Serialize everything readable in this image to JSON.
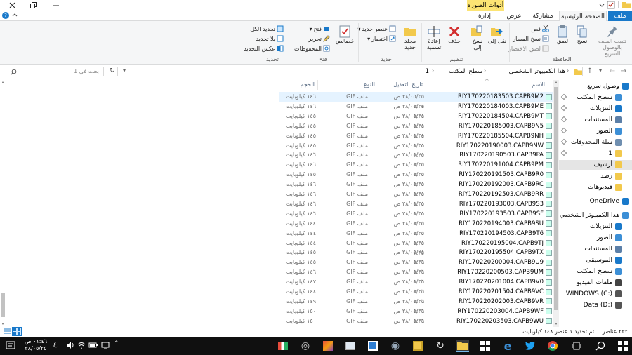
{
  "window": {
    "context_tab_title": "أدوات الصورة"
  },
  "tabs": {
    "file": "ملف",
    "home": "الصفحة الرئيسية",
    "share": "مشاركة",
    "view": "عرض",
    "manage": "إدارة"
  },
  "ribbon": {
    "clipboard": {
      "label": "الحافظة",
      "pin": "تثبيت الملف بالوصول السريع",
      "copy": "نسخ",
      "paste": "لصق",
      "cut": "قص",
      "copy_path": "نسخ المسار",
      "paste_shortcut": "لصق الاختصار"
    },
    "organize": {
      "label": "تنظيم",
      "move_to": "نقل إلى",
      "copy_to": "نسخ إلى",
      "delete": "حذف",
      "rename": "إعادة تسمية"
    },
    "new": {
      "label": "جديد",
      "new_folder": "مجلد جديد",
      "new_item": "عنصر جديد",
      "easy_access": "اختصار"
    },
    "open": {
      "label": "فتح",
      "properties": "خصائص",
      "open": "فتح",
      "edit": "تحرير",
      "history": "المحفوظات"
    },
    "select": {
      "label": "تحديد",
      "select_all": "تحديد الكل",
      "select_none": "بلا تحديد",
      "invert": "عكس التحديد"
    }
  },
  "address": {
    "crumbs": [
      "هذا الكمبيوتر الشخصي",
      "سطح المكتب",
      "1"
    ],
    "search_placeholder": "بحث في 1"
  },
  "nav": [
    {
      "label": "وصول سريع",
      "icon": "star-icon",
      "pinned": false,
      "color": "#1979ca"
    },
    {
      "label": "سطح المكتب",
      "icon": "desktop-icon",
      "pinned": true,
      "color": "#3c8fd6"
    },
    {
      "label": "التنزيلات",
      "icon": "download-icon",
      "pinned": true,
      "color": "#1979ca"
    },
    {
      "label": "المستندات",
      "icon": "document-icon",
      "pinned": true,
      "color": "#5b7fa8"
    },
    {
      "label": "الصور",
      "icon": "pictures-icon",
      "pinned": true,
      "color": "#3c8fd6"
    },
    {
      "label": "سلة المحذوفات",
      "icon": "recycle-bin-icon",
      "pinned": true,
      "color": "#6f8fb0"
    },
    {
      "label": "1",
      "icon": "folder-icon",
      "pinned": true,
      "color": "#f2c94c"
    },
    {
      "label": "أرشيف",
      "icon": "folder-icon",
      "pinned": false,
      "color": "#f2c94c"
    },
    {
      "label": "رصد",
      "icon": "folder-icon",
      "pinned": false,
      "color": "#f2c94c"
    },
    {
      "label": "فيديوهات",
      "icon": "folder-icon",
      "pinned": false,
      "color": "#f2c94c"
    },
    {
      "label": "OneDrive",
      "icon": "cloud-icon",
      "pinned": false,
      "color": "#1979ca"
    },
    {
      "label": "هذا الكمبيوتر الشخصي",
      "icon": "computer-icon",
      "pinned": false,
      "color": "#3c8fd6"
    },
    {
      "label": "التنزيلات",
      "icon": "download-icon",
      "pinned": false,
      "color": "#1979ca"
    },
    {
      "label": "الصور",
      "icon": "pictures-icon",
      "pinned": false,
      "color": "#3c8fd6"
    },
    {
      "label": "المستندات",
      "icon": "document-icon",
      "pinned": false,
      "color": "#5b7fa8"
    },
    {
      "label": "الموسيقى",
      "icon": "music-icon",
      "pinned": false,
      "color": "#1979ca"
    },
    {
      "label": "سطح المكتب",
      "icon": "desktop-icon",
      "pinned": false,
      "color": "#3c8fd6"
    },
    {
      "label": "ملفات الفيديو",
      "icon": "video-icon",
      "pinned": false,
      "color": "#444444"
    },
    {
      "label": "WINDOWS (C:)",
      "icon": "drive-icon",
      "pinned": false,
      "color": "#555555"
    },
    {
      "label": "Data (D:)",
      "icon": "drive-icon",
      "pinned": false,
      "color": "#555555"
    }
  ],
  "columns": {
    "name": "الاسم",
    "date": "تاريخ التعديل",
    "type": "النوع",
    "size": "الحجم"
  },
  "files": [
    {
      "name": "RIY170220183503.CAPB9M2",
      "date": "٣٨/٠٥/٢٥ ص ٠١:٣٤",
      "type": "ملف GIF",
      "size": "١٤٦ كيلوبايت"
    },
    {
      "name": "RIY170220184003.CAPB9ME",
      "date": "٣٨/٠٥/٢٥ ص ٠١:٣٤",
      "type": "ملف GIF",
      "size": "١٤٦ كيلوبايت"
    },
    {
      "name": "RIY170220184504.CAPB9MT",
      "date": "٣٨/٠٥/٢٥ ص ٠١:٣٤",
      "type": "ملف GIF",
      "size": "١٤٥ كيلوبايت"
    },
    {
      "name": "RIY170220185003.CAPB9N5",
      "date": "٣٨/٠٥/٢٥ ص ٠١:٣٤",
      "type": "ملف GIF",
      "size": "١٤٥ كيلوبايت"
    },
    {
      "name": "RIY170220185504.CAPB9NH",
      "date": "٣٨/٠٥/٢٥ ص ٠١:٣٥",
      "type": "ملف GIF",
      "size": "١٤٥ كيلوبايت"
    },
    {
      "name": "RIY170220190003.CAPB9NW",
      "date": "٣٨/٠٥/٢٥ ص ٠١:٣٥",
      "type": "ملف GIF",
      "size": "١٤٥ كيلوبايت"
    },
    {
      "name": "RIY170220190503.CAPB9PA",
      "date": "٣٨/٠٥/٢٥ ص ٠١:٣٥",
      "type": "ملف GIF",
      "size": "١٤٦ كيلوبايت"
    },
    {
      "name": "RIY170220191004.CAPB9PM",
      "date": "٣٨/٠٥/٢٥ ص ٠١:٣٥",
      "type": "ملف GIF",
      "size": "١٤٦ كيلوبايت"
    },
    {
      "name": "RIY170220191503.CAPB9R0",
      "date": "٣٨/٠٥/٢٥ ص ٠١:٣٥",
      "type": "ملف GIF",
      "size": "١٤٥ كيلوبايت"
    },
    {
      "name": "RIY170220192003.CAPB9RC",
      "date": "٣٨/٠٥/٢٥ ص ٠١:٣٥",
      "type": "ملف GIF",
      "size": "١٤٦ كيلوبايت"
    },
    {
      "name": "RIY170220192503.CAPB9RR",
      "date": "٣٨/٠٥/٢٥ ص ٠١:٣٥",
      "type": "ملف GIF",
      "size": "١٤٦ كيلوبايت"
    },
    {
      "name": "RIY170220193003.CAPB9S3",
      "date": "٣٨/٠٥/٢٥ ص ٠١:٣٥",
      "type": "ملف GIF",
      "size": "١٤٦ كيلوبايت"
    },
    {
      "name": "RIY170220193503.CAPB9SF",
      "date": "٣٨/٠٥/٢٥ ص ٠١:٣٥",
      "type": "ملف GIF",
      "size": "١٤٦ كيلوبايت"
    },
    {
      "name": "RIY170220194003.CAPB9SU",
      "date": "٣٨/٠٥/٢٥ ص ٠١:٣٥",
      "type": "ملف GIF",
      "size": "١٤٤ كيلوبايت"
    },
    {
      "name": "RIY170220194503.CAPB9T6",
      "date": "٣٨/٠٥/٢٥ ص ٠١:٣٥",
      "type": "ملف GIF",
      "size": "١٤٤ كيلوبايت"
    },
    {
      "name": "RIY170220195004.CAPB9TJ",
      "date": "٣٨/٠٥/٢٥ ص ٠١:٣٥",
      "type": "ملف GIF",
      "size": "١٤٤ كيلوبايت"
    },
    {
      "name": "RIY170220195504.CAPB9TX",
      "date": "٣٨/٠٥/٢٥ ص ٠١:٣٦",
      "type": "ملف GIF",
      "size": "١٤٥ كيلوبايت"
    },
    {
      "name": "RIY170220200004.CAPB9U9",
      "date": "٣٨/٠٥/٢٥ ص ٠١:٣٦",
      "type": "ملف GIF",
      "size": "١٤٥ كيلوبايت"
    },
    {
      "name": "RIY170220200503.CAPB9UM",
      "date": "٣٨/٠٥/٢٥ ص ٠١:٣٦",
      "type": "ملف GIF",
      "size": "١٤٦ كيلوبايت"
    },
    {
      "name": "RIY170220201004.CAPB9V0",
      "date": "٣٨/٠٥/٢٥ ص ٠١:٣٦",
      "type": "ملف GIF",
      "size": "١٤٧ كيلوبايت"
    },
    {
      "name": "RIY170220201504.CAPB9VC",
      "date": "٣٨/٠٥/٢٥ ص ٠١:٣٦",
      "type": "ملف GIF",
      "size": "١٤٨ كيلوبايت"
    },
    {
      "name": "RIY170220202003.CAPB9VR",
      "date": "٣٨/٠٥/٢٥ ص ٠١:٣٦",
      "type": "ملف GIF",
      "size": "١٤٩ كيلوبايت"
    },
    {
      "name": "RIY170220203004.CAPB9WF",
      "date": "٣٨/٠٥/٢٥ ص ٠١:٣٦",
      "type": "ملف GIF",
      "size": "١٥٠ كيلوبايت"
    },
    {
      "name": "RIY170220203503.CAPB9WU",
      "date": "٣٨/٠٥/٢٥ ص ٠١:٣٦",
      "type": "ملف GIF",
      "size": "١٥٠ كيلوبايت"
    }
  ],
  "selected_index": 0,
  "status": {
    "count": "٣٣٢ عناصر",
    "selection": "تم تحديد ١ عنصر  ١٤٨ كيلوبايت"
  },
  "taskbar": {
    "time": "٠١:٤٦ ص",
    "date": "٣٨/٠٥/٢٥",
    "lang": "ع"
  },
  "colors": {
    "accent": "#1979ca",
    "selection": "#cce8ff",
    "folder": "#f2c94c"
  }
}
